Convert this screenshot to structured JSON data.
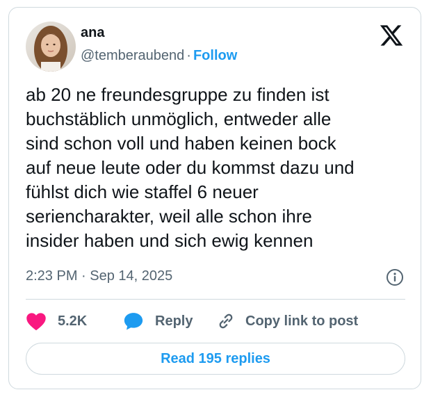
{
  "post": {
    "author_name": "ana",
    "author_handle": "@temberaubend",
    "separator": "·",
    "follow_label": "Follow",
    "text_lines": [
      "ab 20 ne freundesgruppe zu finden ist",
      "buchstäblich unmöglich, entweder alle",
      "sind schon voll und haben keinen bock",
      "auf neue leute oder du kommst dazu und",
      "fühlst dich wie staffel 6 neuer",
      "seriencharakter, weil alle schon ihre",
      "insider haben und sich ewig kennen"
    ],
    "timestamp": "2:23 PM · Sep 14, 2025"
  },
  "actions": {
    "like_count": "5.2K",
    "reply_label": "Reply",
    "copy_link_label": "Copy link to post"
  },
  "read_replies_label": "Read 195 replies",
  "icons": {
    "logo": "x-logo-icon",
    "info": "info-icon",
    "like": "heart-icon",
    "reply": "speech-bubble-icon",
    "copy": "link-icon"
  },
  "colors": {
    "accent": "#1d9bf0",
    "like": "#f91880",
    "text": "#0f1419",
    "muted": "#536471",
    "border": "#cfd9de"
  }
}
